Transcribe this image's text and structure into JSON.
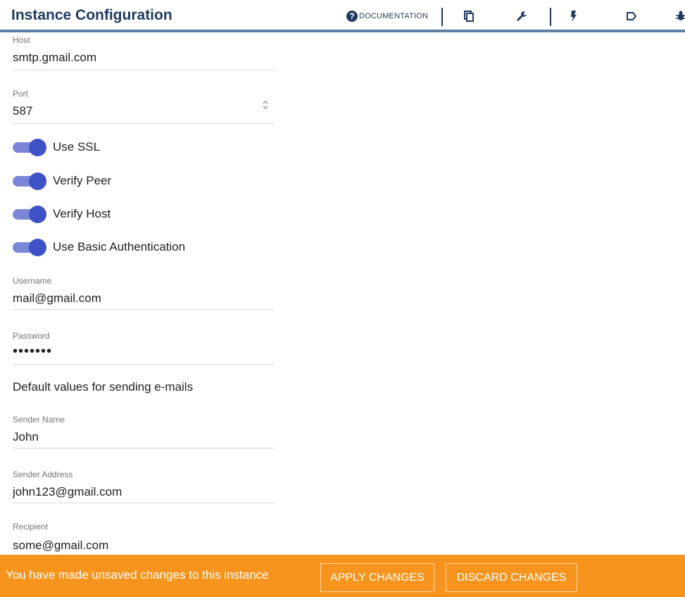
{
  "header": {
    "title": "Instance Configuration",
    "documentation_label": "DOCUMENTATION",
    "icons": [
      "help-circle-icon",
      "copy-icon",
      "wrench-icon",
      "flash-icon",
      "tag-icon",
      "bug-icon"
    ]
  },
  "form": {
    "host": {
      "label": "Host",
      "value": "smtp.gmail.com"
    },
    "port": {
      "label": "Port",
      "value": "587"
    },
    "toggles": [
      {
        "label": "Use SSL",
        "on": true
      },
      {
        "label": "Verify Peer",
        "on": true
      },
      {
        "label": "Verify Host",
        "on": true
      },
      {
        "label": "Use Basic Authentication",
        "on": true
      }
    ],
    "username": {
      "label": "Username",
      "value": "mail@gmail.com"
    },
    "password": {
      "label": "Password",
      "value": "•••••••"
    },
    "defaults_title": "Default values for sending e-mails",
    "sender_name": {
      "label": "Sender Name",
      "value": "John"
    },
    "sender_address": {
      "label": "Sender Address",
      "value": "john123@gmail.com"
    },
    "recipient": {
      "label": "Recipient",
      "value": "some@gmail.com"
    }
  },
  "bottom_bar": {
    "message": "You have made unsaved changes to this instance",
    "apply_label": "APPLY CHANGES",
    "discard_label": "DISCARD CHANGES"
  },
  "colors": {
    "header_text": "#1e3a5f",
    "toggle_on": "#3f51c7",
    "warning_bar": "#f7941d"
  }
}
